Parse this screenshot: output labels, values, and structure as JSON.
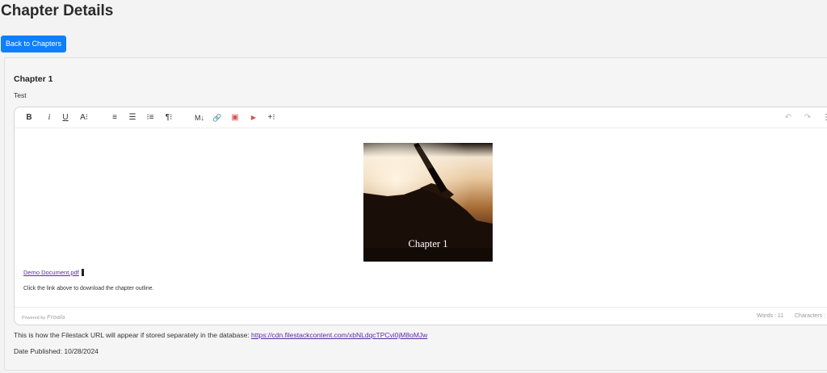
{
  "page": {
    "title": "Chapter Details",
    "back_button_label": "Back to Chapters"
  },
  "chapter": {
    "title": "Chapter 1",
    "description": "Test"
  },
  "editor": {
    "toolbar": {
      "bold": "B",
      "italic": "i",
      "underline": "U",
      "font_size": "A⁝",
      "align": "≡",
      "paragraph_format": "☰",
      "ordered_list": "⁝≡",
      "paragraph_style": "¶⁝",
      "markdown": "M↓",
      "insert_link": "🔗",
      "insert_image": "▣",
      "insert_video": "▶",
      "more": "+⁝",
      "undo": "↶",
      "redo": "↷",
      "more_options": "⋮"
    },
    "image_caption": "Chapter 1",
    "document_link": "Demo Document.pdf",
    "content_text": "Click the link above to download the chapter outline.",
    "powered_by": "Powered by",
    "powered_logo": "Froala",
    "word_count": "Words : 11",
    "character_count": "Characters :"
  },
  "filestack": {
    "text": "This is how the Filestack URL will appear if stored separately in the database:",
    "url": "https://cdn.filestackcontent.com/xbNLdqcTPCvi0jM8oMJw"
  },
  "date_published": "Date Published: 10/28/2024",
  "colors": {
    "primary_button": "#0d7fff",
    "link": "#5a2ba6"
  }
}
